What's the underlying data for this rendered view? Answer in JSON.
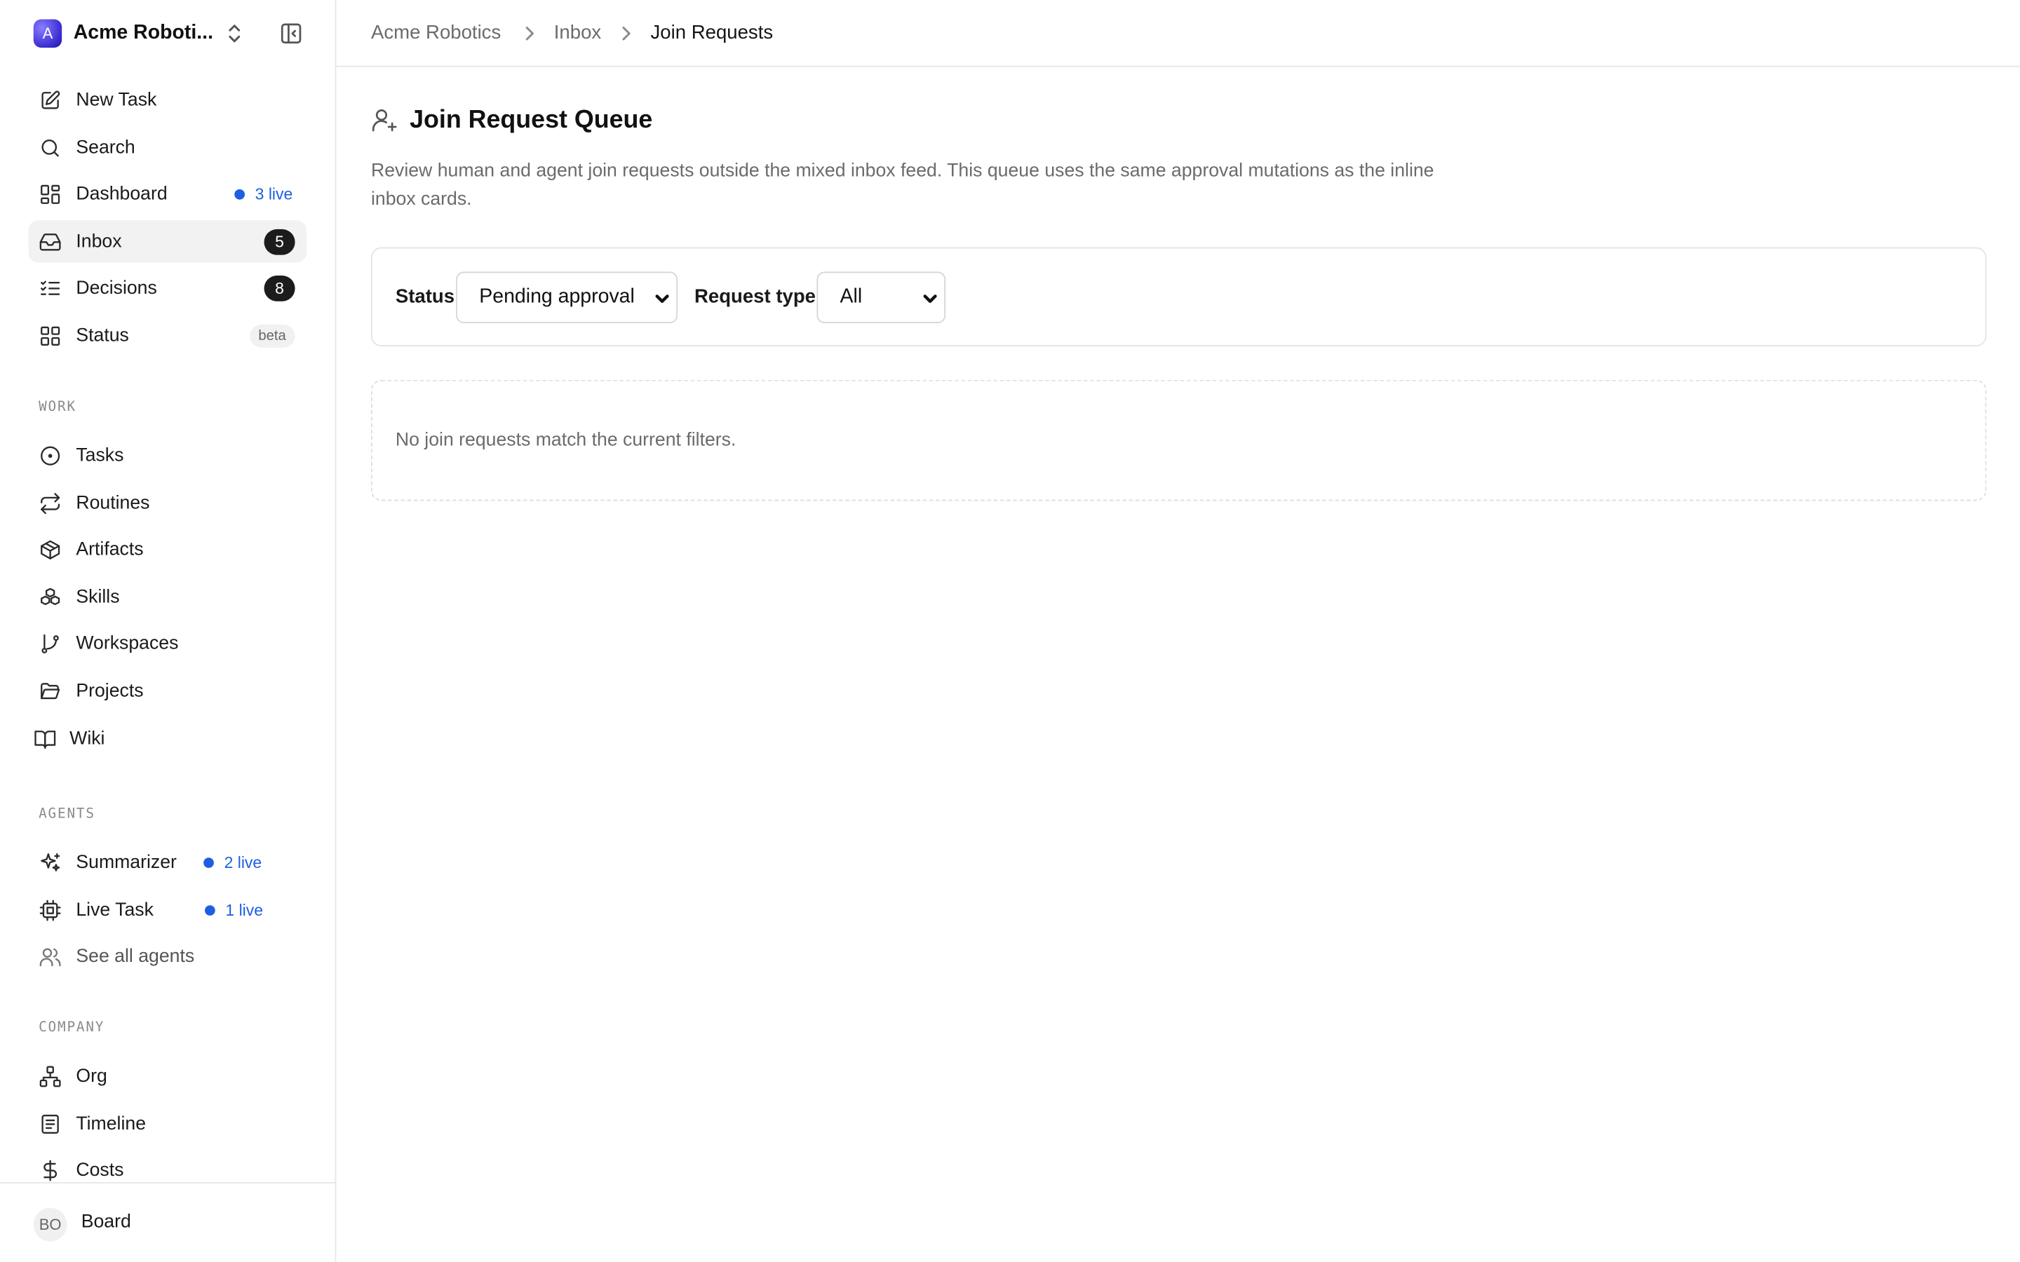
{
  "company": {
    "name": "Acme Roboti...",
    "logo_letter": "A"
  },
  "nav": {
    "new_task": "New Task",
    "search": "Search",
    "dashboard": {
      "label": "Dashboard",
      "live": "3 live"
    },
    "inbox": {
      "label": "Inbox",
      "count": "5"
    },
    "decisions": {
      "label": "Decisions",
      "count": "8"
    },
    "status": {
      "label": "Status",
      "badge": "beta"
    }
  },
  "sections": {
    "work": {
      "label": "WORK",
      "items": [
        "Tasks",
        "Routines",
        "Artifacts",
        "Skills",
        "Workspaces",
        "Projects",
        "Wiki"
      ]
    },
    "agents": {
      "label": "AGENTS",
      "summarizer": {
        "label": "Summarizer",
        "live": "2 live"
      },
      "live_task": {
        "label": "Live Task",
        "live": "1 live"
      },
      "see_all": "See all agents"
    },
    "company": {
      "label": "COMPANY",
      "items": [
        "Org",
        "Timeline",
        "Costs"
      ]
    }
  },
  "footer": {
    "avatar_initials": "BO",
    "label": "Board"
  },
  "breadcrumb": [
    "Acme Robotics",
    "Inbox",
    "Join Requests"
  ],
  "page": {
    "title": "Join Request Queue",
    "description": "Review human and agent join requests outside the mixed inbox feed. This queue uses the same approval mutations as the inline inbox cards."
  },
  "filters": {
    "status_label": "Status",
    "status_value": "Pending approval",
    "type_label": "Request type",
    "type_value": "All"
  },
  "empty_state": "No join requests match the current filters.",
  "colors": {
    "accent": "#1d5fe0",
    "badge_bg": "#1c1c1c",
    "active_bg": "#f2f2f2"
  }
}
